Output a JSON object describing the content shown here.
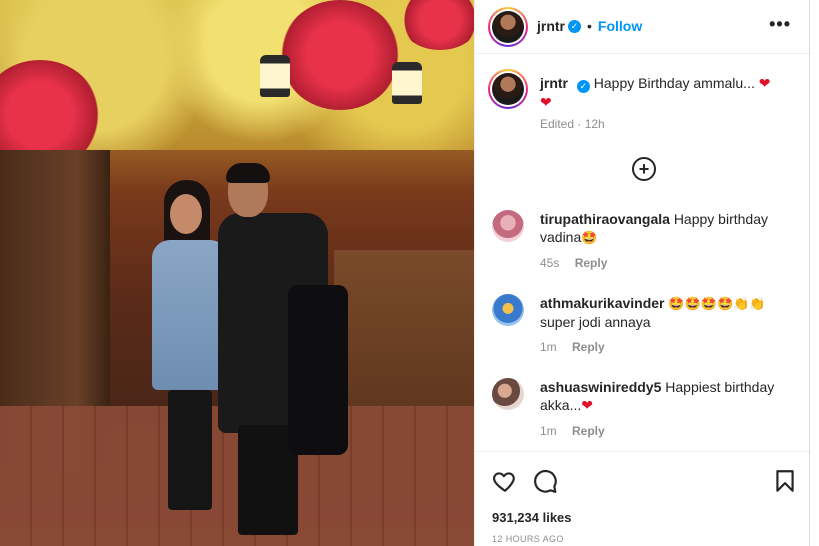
{
  "post": {
    "image_alt": "",
    "username": "jrntr",
    "verified_glyph": "✓",
    "dot": "•",
    "follow_label": "Follow",
    "more_label": "•••"
  },
  "caption": {
    "username": "jrntr",
    "text": "Happy Birthday ammalu...",
    "heart": "❤",
    "heart2": "❤",
    "meta": "Edited · 12h"
  },
  "load_more_label": "+",
  "comments": [
    {
      "username": "tirupathiraovangala",
      "text": "Happy birthday vadina",
      "emoji": "🤩",
      "time": "45s",
      "reply": "Reply"
    },
    {
      "username": "athmakurikavinder",
      "text": "🤩🤩🤩🤩👏👏",
      "text2": "super jodi annaya",
      "time": "1m",
      "reply": "Reply"
    },
    {
      "username": "ashuaswinireddy5",
      "text": "Happiest birthday akka...",
      "emoji": "❤",
      "time": "1m",
      "reply": "Reply"
    }
  ],
  "footer": {
    "likes": "931,234 likes",
    "time": "12 HOURS AGO"
  },
  "icons": {
    "like": "heart-icon",
    "comment": "comment-icon",
    "save": "bookmark-icon",
    "more": "more-options-icon"
  },
  "colors": {
    "accent": "#0095f6",
    "heart": "#e0102a",
    "muted": "#8e8e8e"
  }
}
